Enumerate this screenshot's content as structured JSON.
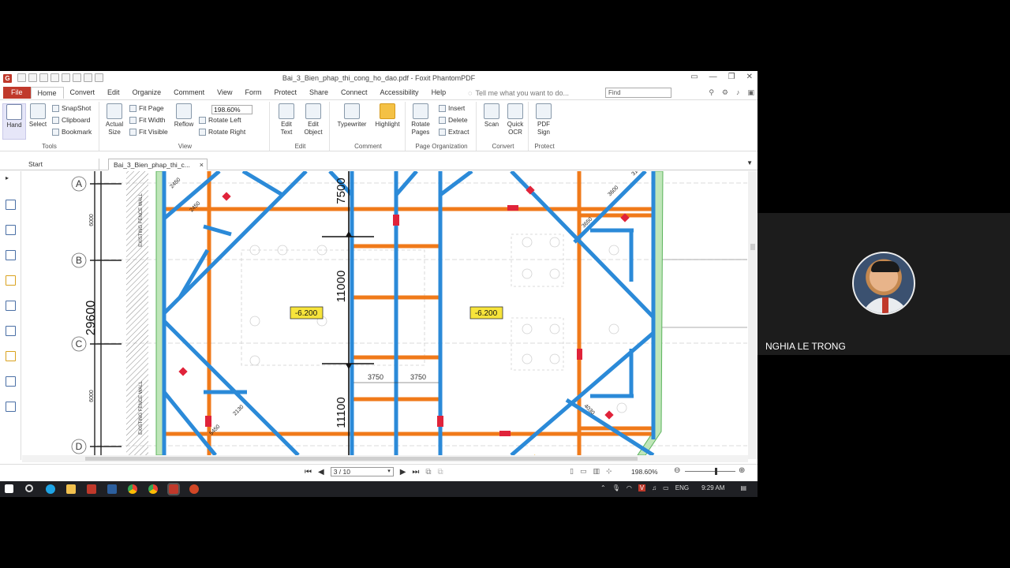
{
  "window": {
    "title": "Bai_3_Bien_phap_thi_cong_ho_dao.pdf - Foxit PhantomPDF",
    "controls": [
      "▭",
      "—",
      "❐",
      "✕"
    ]
  },
  "menu": {
    "items": [
      "File",
      "Home",
      "Convert",
      "Edit",
      "Organize",
      "Comment",
      "View",
      "Form",
      "Protect",
      "Share",
      "Connect",
      "Accessibility",
      "Help"
    ],
    "tell_me": "Tell me what you want to do...",
    "find_placeholder": "Find"
  },
  "ribbon": {
    "tools": {
      "label": "Tools",
      "hand": "Hand",
      "select": "Select",
      "snapshot": "SnapShot",
      "clipboard": "Clipboard",
      "bookmark": "Bookmark"
    },
    "view": {
      "label": "View",
      "actual_size_1": "Actual",
      "actual_size_2": "Size",
      "fit_page": "Fit Page",
      "fit_width": "Fit Width",
      "fit_visible": "Fit Visible",
      "reflow": "Reflow",
      "zoom": "198.60%",
      "rotate_left": "Rotate Left",
      "rotate_right": "Rotate Right"
    },
    "edit": {
      "label": "Edit",
      "edit_text_1": "Edit",
      "edit_text_2": "Text",
      "edit_object_1": "Edit",
      "edit_object_2": "Object"
    },
    "comment": {
      "label": "Comment",
      "typewriter": "Typewriter",
      "highlight": "Highlight"
    },
    "page_org": {
      "label": "Page Organization",
      "rotate_1": "Rotate",
      "rotate_2": "Pages",
      "insert": "Insert",
      "delete": "Delete",
      "extract": "Extract"
    },
    "convert": {
      "label": "Convert",
      "scan": "Scan",
      "ocr_1": "Quick",
      "ocr_2": "OCR"
    },
    "protect": {
      "label": "Protect",
      "sign_1": "PDF",
      "sign_2": "Sign"
    }
  },
  "tabs": {
    "start": "Start",
    "doc": "Bai_3_Bien_phap_thi_c...",
    "close": "×"
  },
  "drawing": {
    "grid_labels": [
      "A",
      "B",
      "C",
      "D"
    ],
    "dim_left_total": "29600",
    "dim_left_a": "6000",
    "dim_left_b": "6000",
    "fence_wall": "EXISTING FENCE WALL",
    "dim_7500": "7500",
    "dim_11000": "11000",
    "dim_11100": "11100",
    "dim_3750_a": "3750",
    "dim_3750_b": "3750",
    "level_1": "-6.200",
    "level_2": "-6.200",
    "diag_labels": [
      "2450",
      "2450",
      "3650",
      "5450",
      "3130",
      "3600",
      "2130",
      "4030"
    ]
  },
  "status": {
    "page": "3 / 10",
    "zoom": "198.60%"
  },
  "taskbar": {
    "lang": "ENG",
    "time": "9:29 AM"
  },
  "participant": {
    "name": "NGHIA LE TRONG"
  },
  "colors": {
    "accent": "#c0392b",
    "strut_blue": "#2b8ad8",
    "waler_orange": "#f07a1a",
    "level_tag": "#f7e43b"
  }
}
